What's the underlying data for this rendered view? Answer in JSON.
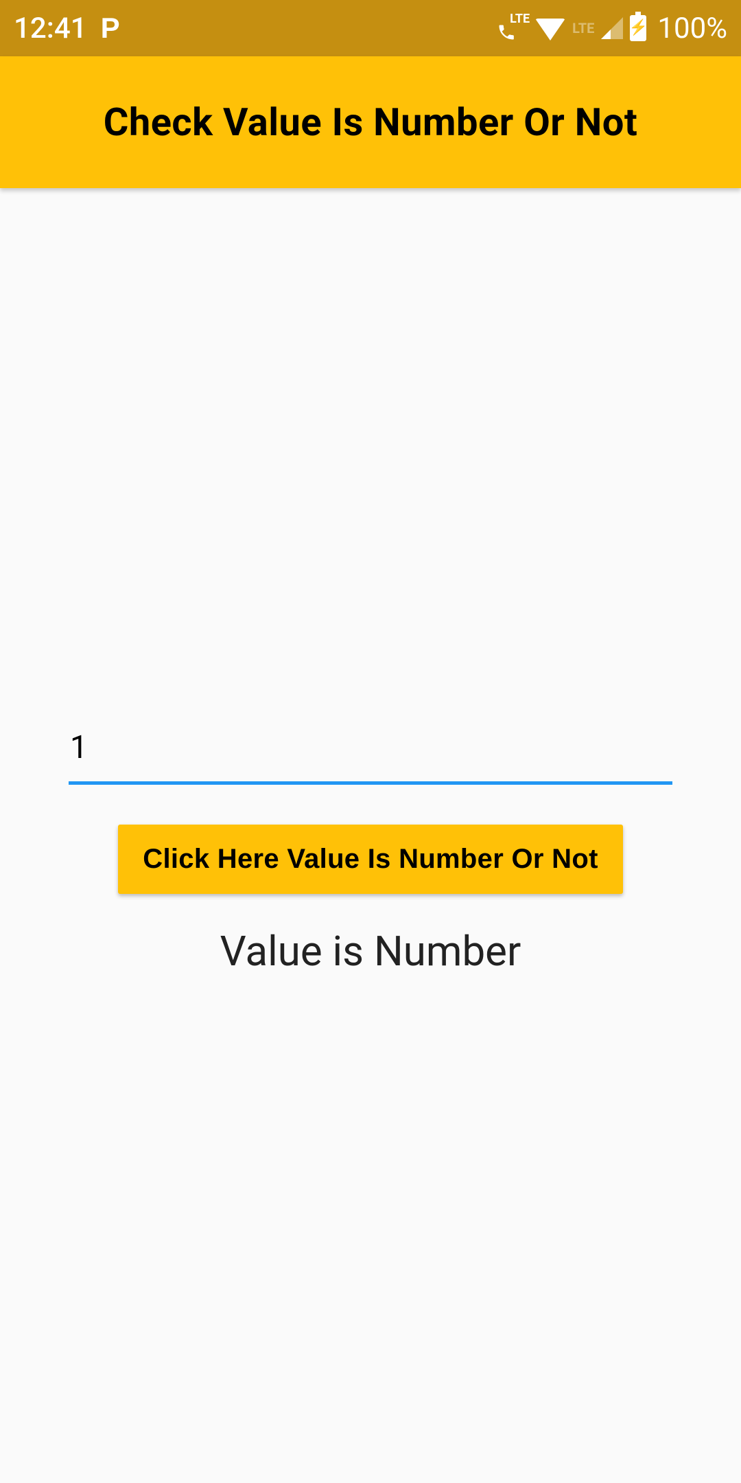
{
  "status_bar": {
    "time": "12:41",
    "p_label": "P",
    "lte_label": "LTE",
    "lte_dim_label": "LTE",
    "battery_pct": "100%"
  },
  "app_bar": {
    "title": "Check Value Is Number Or Not"
  },
  "main": {
    "input_value": "1",
    "button_label": "Click Here Value Is Number Or Not",
    "result_text": "Value is Number"
  },
  "colors": {
    "status_bar_bg": "#c58f11",
    "app_bar_bg": "#ffc107",
    "button_bg": "#ffc107",
    "input_underline": "#2196f3"
  }
}
